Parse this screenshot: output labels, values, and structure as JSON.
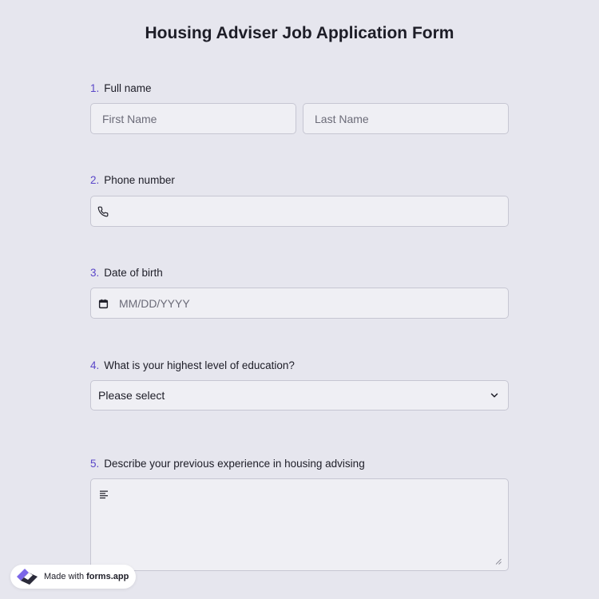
{
  "form": {
    "title": "Housing Adviser Job Application Form"
  },
  "questions": [
    {
      "number": "1.",
      "label": "Full name"
    },
    {
      "number": "2.",
      "label": "Phone number"
    },
    {
      "number": "3.",
      "label": "Date of birth"
    },
    {
      "number": "4.",
      "label": "What is your highest level of education?"
    },
    {
      "number": "5.",
      "label": "Describe your previous experience in housing advising"
    }
  ],
  "fields": {
    "first_name_placeholder": "First Name",
    "last_name_placeholder": "Last Name",
    "phone_value": "",
    "phone_icon": "phone-icon",
    "dob_placeholder": "MM/DD/YYYY",
    "dob_icon": "calendar-icon",
    "education_selected": "Please select",
    "education_icon": "chevron-down-icon",
    "experience_value": "",
    "experience_icon": "text-lines-icon"
  },
  "badge": {
    "prefix": "Made with",
    "brand": "forms.app",
    "logo_icon": "forms-app-logo"
  },
  "colors": {
    "background": "#e6e6ee",
    "accent": "#5a46c8",
    "field_bg": "#efeff4",
    "field_border": "#c6c6d2"
  }
}
